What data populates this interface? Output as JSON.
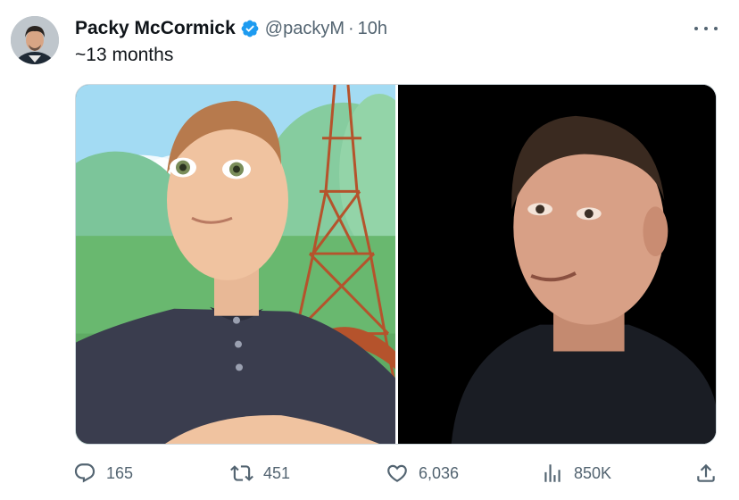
{
  "author": {
    "name": "Packy McCormick",
    "handle": "@packyM",
    "separator": "·",
    "time": "10h",
    "verified": true,
    "avatar_icon": "profile-photo"
  },
  "tweet": {
    "text": "~13 months"
  },
  "media": {
    "left_image": "avatar-with-eiffel-tower",
    "right_image": "person-portrait-dark-background"
  },
  "actions": {
    "replies": "165",
    "retweets": "451",
    "likes": "6,036",
    "views": "850K"
  },
  "colors": {
    "text_primary": "#0f1419",
    "text_secondary": "#536471",
    "verified_blue": "#1d9bf0",
    "border": "#cfd9de"
  }
}
